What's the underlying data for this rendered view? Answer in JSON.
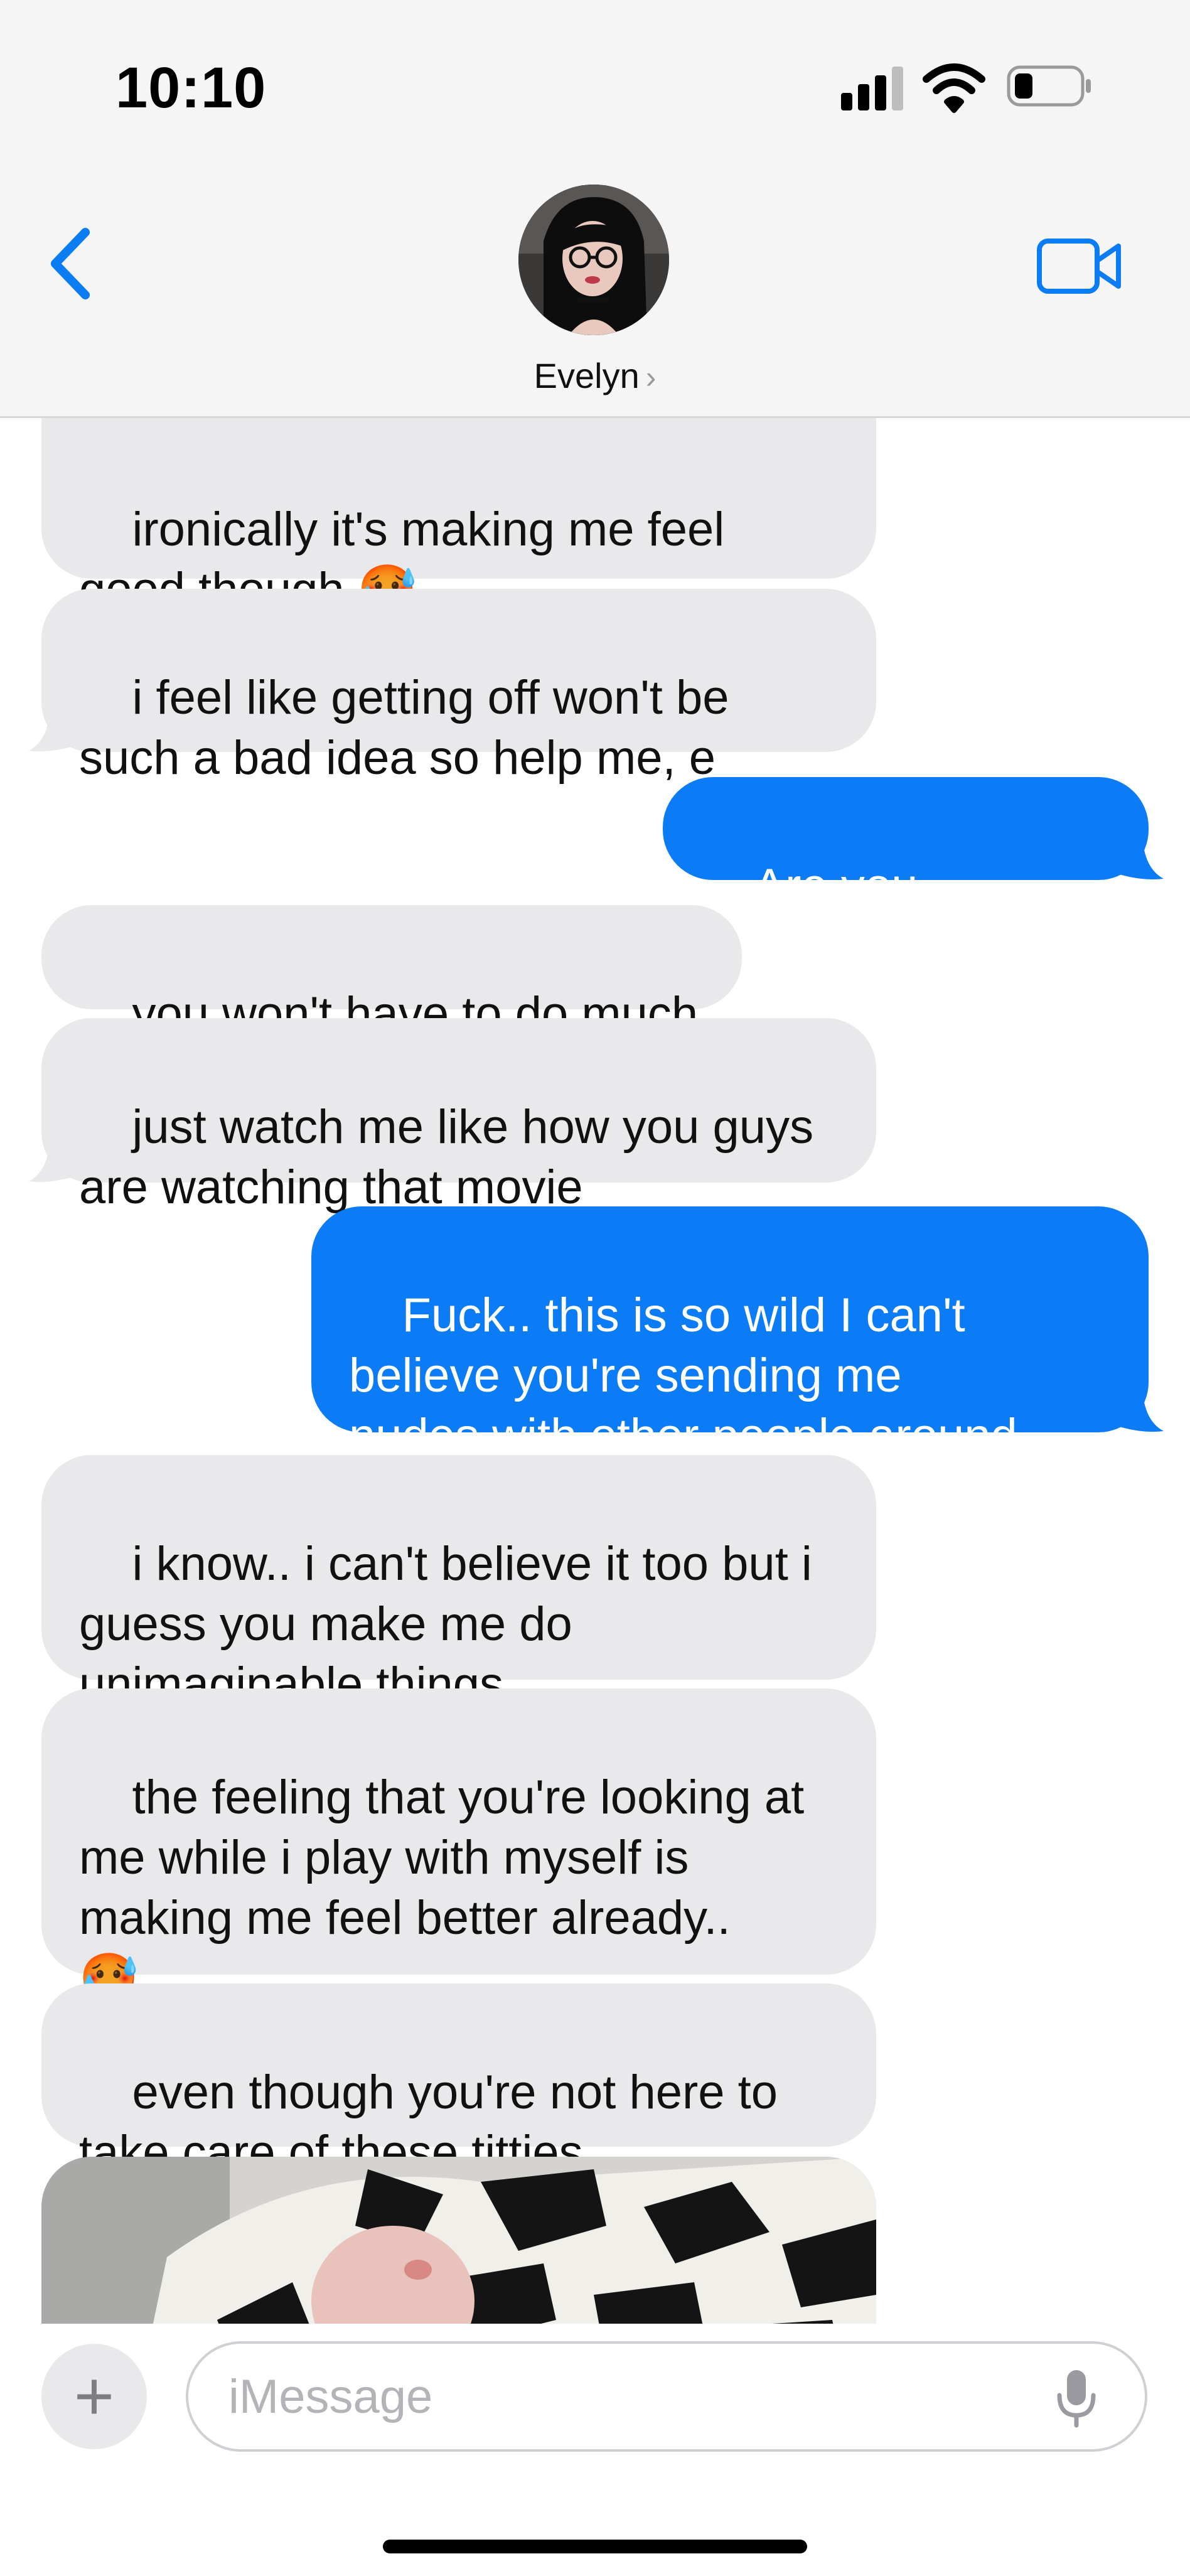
{
  "status_bar": {
    "time": "10:10"
  },
  "header": {
    "contact_name": "Evelyn",
    "name_chevron": "›"
  },
  "messages": [
    {
      "from": "contact",
      "text": "ironically it's making me feel\ngood though 🥵"
    },
    {
      "from": "contact",
      "text": "i feel like getting off won't be\nsuch a bad idea so help me, e"
    },
    {
      "from": "me",
      "text": "Are you serious..?"
    },
    {
      "from": "contact",
      "text": "you won't have to do much"
    },
    {
      "from": "contact",
      "text": "just watch me like how you guys\nare watching that movie"
    },
    {
      "from": "me",
      "text": "Fuck.. this is so wild I can't\nbelieve you're sending me\nnudes with other people around"
    },
    {
      "from": "contact",
      "text": "i know.. i can't believe it too but i\nguess you make me do\nunimaginable things"
    },
    {
      "from": "contact",
      "text": "the feeling that you're looking at\nme while i play with myself is\nmaking me feel better already..\n🥵"
    },
    {
      "from": "contact",
      "text": "even though you're not here to\ntake care of these titties"
    }
  ],
  "composer": {
    "placeholder": "iMessage",
    "plus": "+"
  },
  "icons": {
    "back": "chevron-left-icon",
    "video": "video-camera-icon",
    "mic": "microphone-icon",
    "signal": "cellular-signal-icon",
    "wifi": "wifi-icon",
    "battery": "battery-icon"
  },
  "colors": {
    "outgoing_bubble": "#0b7cf5",
    "incoming_bubble": "#e9e9eb",
    "accent": "#0a7cf4"
  }
}
